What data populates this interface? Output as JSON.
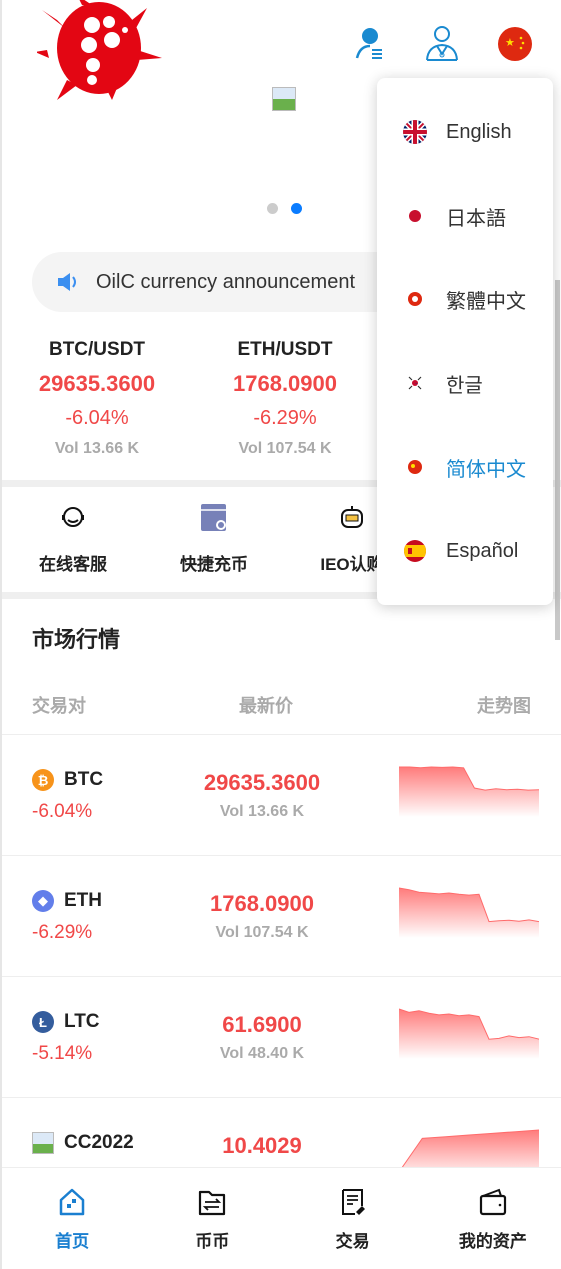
{
  "header": {
    "icons": [
      "user-list-icon",
      "customer-service-icon",
      "china-flag-icon"
    ]
  },
  "banner": {
    "active_dot": 1,
    "dots": 2
  },
  "notice": {
    "text": "OilC currency announcement"
  },
  "tickers": [
    {
      "pair": "BTC/USDT",
      "price": "29635.3600",
      "change": "-6.04%",
      "vol": "Vol 13.66 K"
    },
    {
      "pair": "ETH/USDT",
      "price": "1768.0900",
      "change": "-6.29%",
      "vol": "Vol 107.54 K"
    }
  ],
  "quick_links": [
    {
      "label": "在线客服",
      "icon": "headset-icon"
    },
    {
      "label": "快捷充币",
      "icon": "deposit-icon"
    },
    {
      "label": "IEO认购",
      "icon": "robot-icon"
    }
  ],
  "market": {
    "title": "市场行情",
    "headers": [
      "交易对",
      "最新价",
      "走势图"
    ],
    "rows": [
      {
        "coin": "BTC",
        "change": "-6.04%",
        "price": "29635.3600",
        "vol": "Vol 13.66 K",
        "color": "#f7931a",
        "trend": [
          10,
          10,
          9.8,
          10,
          9.9,
          10,
          9.8,
          5,
          4.5,
          4.8,
          4.6,
          4.7,
          4.5,
          4.6
        ]
      },
      {
        "coin": "ETH",
        "change": "-6.29%",
        "price": "1768.0900",
        "vol": "Vol 107.54 K",
        "color": "#627eea",
        "trend": [
          10,
          9.6,
          9,
          8.8,
          8.6,
          8.8,
          8.5,
          8.3,
          8.5,
          2,
          2.2,
          2.3,
          2.1,
          2.4,
          2
        ]
      },
      {
        "coin": "LTC",
        "change": "-5.14%",
        "price": "61.6900",
        "vol": "Vol 48.40 K",
        "color": "#345d9d",
        "trend": [
          10,
          9.2,
          9.6,
          9,
          8.6,
          8.8,
          8.4,
          8.6,
          8.2,
          2.8,
          3,
          3.6,
          3.2,
          3.4,
          2.8
        ]
      },
      {
        "coin": "CC2022",
        "change": "",
        "price": "10.4029",
        "vol": "",
        "color": "",
        "trend": [
          0,
          8,
          8.4,
          8.8,
          9.2,
          9.6,
          10
        ]
      }
    ]
  },
  "nav": [
    {
      "label": "首页",
      "icon": "home-icon",
      "active": true
    },
    {
      "label": "币币",
      "icon": "exchange-folder-icon"
    },
    {
      "label": "交易",
      "icon": "trade-doc-icon"
    },
    {
      "label": "我的资产",
      "icon": "wallet-icon"
    }
  ],
  "language_menu": {
    "options": [
      {
        "label": "English",
        "flag": "uk-flag-icon"
      },
      {
        "label": "日本語",
        "flag": "japan-flag-icon"
      },
      {
        "label": "繁體中文",
        "flag": "hongkong-flag-icon"
      },
      {
        "label": "한글",
        "flag": "korea-flag-icon"
      },
      {
        "label": "简体中文",
        "flag": "china-flag-icon",
        "selected": true
      },
      {
        "label": "Español",
        "flag": "spain-flag-icon"
      }
    ]
  },
  "colors": {
    "up_down_red": "#f04848",
    "accent_blue": "#1a8ad0"
  }
}
